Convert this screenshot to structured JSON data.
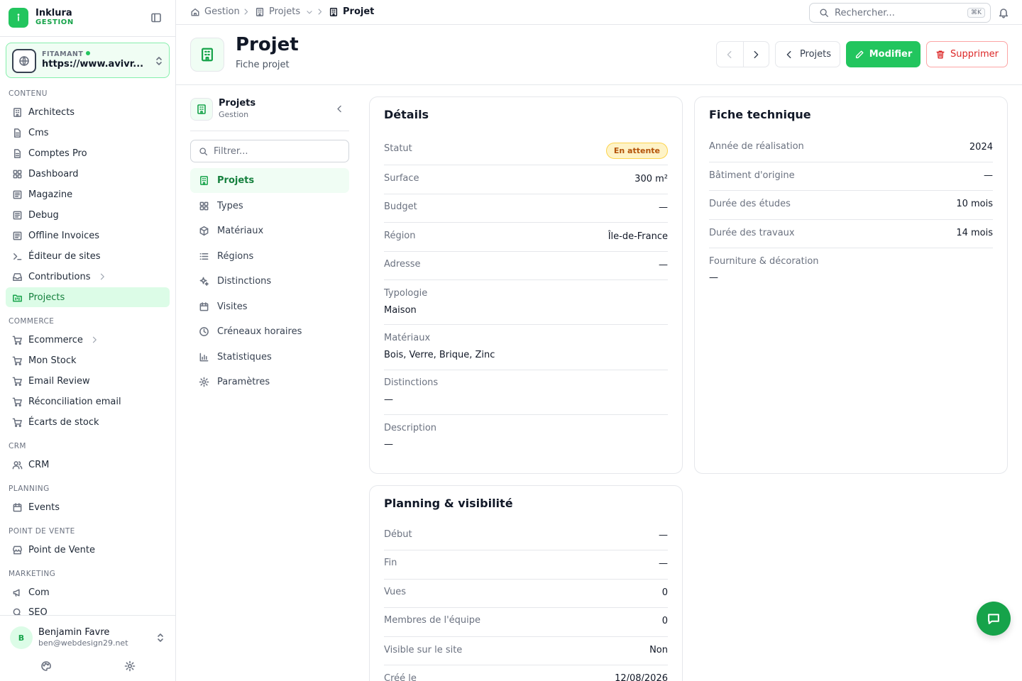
{
  "brand": {
    "name": "Inklura",
    "sub": "GESTION"
  },
  "site": {
    "label": "FITAMANT",
    "url": "https://www.avivr..."
  },
  "sidebar": {
    "sections": {
      "contenu": "CONTENU",
      "commerce": "COMMERCE",
      "crm": "CRM",
      "planning": "PLANNING",
      "pdv": "POINT DE VENTE",
      "marketing": "MARKETING"
    },
    "items": {
      "architects": "Architects",
      "cms": "Cms",
      "comptes": "Comptes Pro",
      "dashboard": "Dashboard",
      "magazine": "Magazine",
      "debug": "Debug",
      "offline": "Offline Invoices",
      "editeur": "Éditeur de sites",
      "contributions": "Contributions",
      "projects": "Projects",
      "ecommerce": "Ecommerce",
      "stock": "Mon Stock",
      "email_review": "Email Review",
      "reconciliation": "Réconciliation email",
      "ecarts": "Écarts de stock",
      "crm": "CRM",
      "events": "Events",
      "pdv": "Point de Vente",
      "com": "Com",
      "seo": "SEO"
    }
  },
  "user": {
    "initial": "B",
    "name": "Benjamin Favre",
    "email": "ben@webdesign29.net"
  },
  "breadcrumb": {
    "home": "Gestion",
    "section": "Projets",
    "current": "Projet"
  },
  "search": {
    "placeholder": "Rechercher...",
    "shortcut": "⌘K"
  },
  "header": {
    "title": "Projet",
    "subtitle": "Fiche projet",
    "back_label": "Projets",
    "edit_label": "Modifier",
    "delete_label": "Supprimer"
  },
  "subnav": {
    "title": "Projets",
    "sub": "Gestion",
    "filter_placeholder": "Filtrer...",
    "items": {
      "projets": "Projets",
      "types": "Types",
      "materiaux": "Matériaux",
      "regions": "Régions",
      "distinctions": "Distinctions",
      "visites": "Visites",
      "creneaux": "Créneaux horaires",
      "statistiques": "Statistiques",
      "parametres": "Paramètres"
    }
  },
  "details": {
    "title": "Détails",
    "statut_label": "Statut",
    "statut_value": "En attente",
    "surface_label": "Surface",
    "surface_value": "300 m²",
    "budget_label": "Budget",
    "budget_value": "—",
    "region_label": "Région",
    "region_value": "Île-de-France",
    "adresse_label": "Adresse",
    "adresse_value": "—",
    "typologie_label": "Typologie",
    "typologie_value": "Maison",
    "materiaux_label": "Matériaux",
    "materiaux_value": "Bois, Verre, Brique, Zinc",
    "distinctions_label": "Distinctions",
    "distinctions_value": "—",
    "description_label": "Description",
    "description_value": "—"
  },
  "fiche": {
    "title": "Fiche technique",
    "annee_label": "Année de réalisation",
    "annee_value": "2024",
    "batiment_label": "Bâtiment d'origine",
    "batiment_value": "—",
    "etudes_label": "Durée des études",
    "etudes_value": "10 mois",
    "travaux_label": "Durée des travaux",
    "travaux_value": "14 mois",
    "fourniture_label": "Fourniture & décoration",
    "fourniture_value": "—"
  },
  "planning": {
    "title": "Planning & visibilité",
    "debut_label": "Début",
    "debut_value": "—",
    "fin_label": "Fin",
    "fin_value": "—",
    "vues_label": "Vues",
    "vues_value": "0",
    "membres_label": "Membres de l'équipe",
    "membres_value": "0",
    "visible_label": "Visible sur le site",
    "visible_value": "Non",
    "cree_label": "Créé le",
    "cree_value": "12/08/2026"
  },
  "colors": {
    "accent": "#22c55e",
    "accent_dark": "#16a34a",
    "danger": "#dc2626",
    "warning_bg": "#fef3c7"
  }
}
